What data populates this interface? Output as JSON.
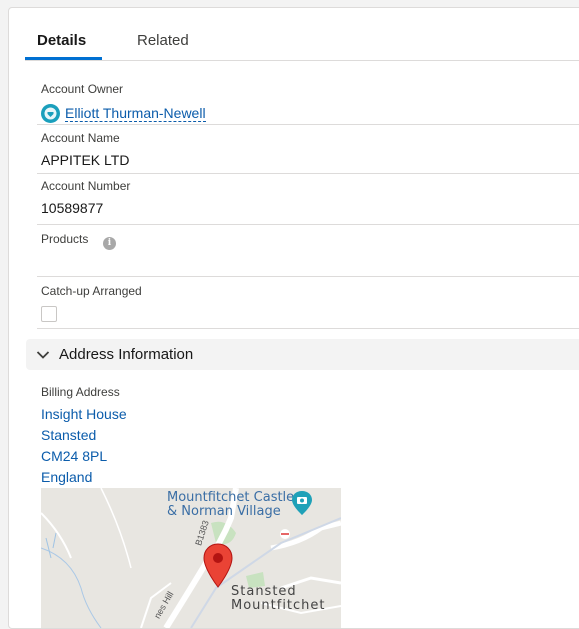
{
  "tabs": [
    {
      "label": "Details",
      "active": true
    },
    {
      "label": "Related",
      "active": false
    }
  ],
  "fields": {
    "account_owner": {
      "label": "Account Owner",
      "value": "Elliott Thurman-Newell"
    },
    "account_name": {
      "label": "Account Name",
      "value": "APPITEK LTD"
    },
    "account_number": {
      "label": "Account Number",
      "value": "10589877"
    },
    "products": {
      "label": "Products",
      "value": ""
    },
    "catch_up": {
      "label": "Catch-up Arranged",
      "checked": false
    }
  },
  "address_section": {
    "title": "Address Information",
    "billing_label": "Billing Address",
    "lines": [
      "Insight House",
      "Stansted",
      "CM24 8PL",
      "England"
    ]
  },
  "map": {
    "poi_line1": "Mountfitchet Castle",
    "poi_line2": "& Norman Village",
    "town_line1": "Stansted",
    "town_line2": "Mountfitchet",
    "road_b1383": "B1383",
    "road_hill": "nes Hill"
  },
  "colors": {
    "accent": "#0070d2",
    "link": "#0b5cab",
    "map_pin": "#ea4335"
  }
}
